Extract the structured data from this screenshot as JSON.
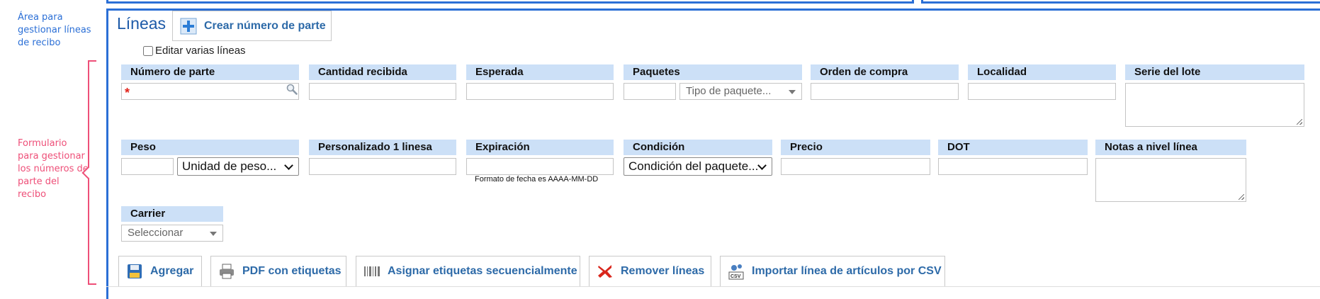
{
  "annotations": {
    "lines_area": "Área para gestionar líneas de recibo",
    "form_area": "Formulario para gestionar los números de parte del recibo"
  },
  "section": {
    "title": "Líneas",
    "create_part_label": "Crear número de parte",
    "edit_multiple_label": "Editar varias líneas"
  },
  "fields": {
    "part_number": "Número de parte",
    "qty_received": "Cantidad recibida",
    "expected": "Esperada",
    "packages": "Paquetes",
    "package_type_placeholder": "Tipo de paquete...",
    "purchase_order": "Orden de compra",
    "location": "Localidad",
    "lot_series": "Serie del lote",
    "weight": "Peso",
    "weight_unit_placeholder": "Unidad de peso...",
    "custom1": "Personalizado 1 linesa",
    "expiration": "Expiración",
    "date_hint": "Formato de fecha es AAAA-MM-DD",
    "condition": "Condición",
    "condition_placeholder": "Condición del paquete...",
    "price": "Precio",
    "dot": "DOT",
    "line_notes": "Notas a nivel línea",
    "carrier": "Carrier",
    "carrier_placeholder": "Seleccionar",
    "required_mark": "*"
  },
  "actions": {
    "add": "Agregar",
    "pdf_labels": "PDF con etiquetas",
    "assign_sequential": "Asignar etiquetas secuencialmente",
    "remove_lines": "Remover líneas",
    "import_csv": "Importar línea de artículos por CSV"
  },
  "colors": {
    "accent_blue": "#2b6fd6",
    "annotation_pink": "#ee4f78",
    "label_bg": "#cce0f7",
    "link_blue": "#2d6aa8"
  }
}
